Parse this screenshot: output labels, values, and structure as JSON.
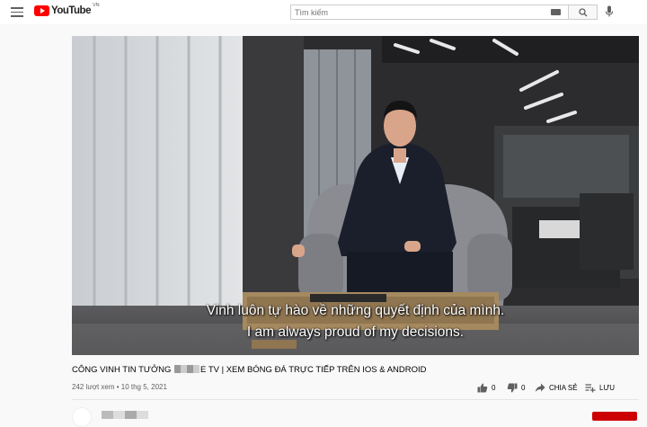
{
  "header": {
    "logo_text": "YouTube",
    "country_code": "VN",
    "search_placeholder": "Tìm kiếm"
  },
  "player": {
    "subtitle_vi": "Vinh luôn tự hào về những quyết định của mình.",
    "subtitle_en": "I am always proud of my decisions."
  },
  "video": {
    "title_prefix": "CÔNG VINH TIN TƯỞNG",
    "title_suffix": "E TV | XEM BÓNG ĐÁ TRỰC TIẾP TRÊN IOS & ANDROID",
    "meta": "242 lượt xem • 10 thg 5, 2021",
    "like_count": "0",
    "dislike_count": "0",
    "share_label": "CHIA SẺ",
    "save_label": "LƯU"
  },
  "colors": {
    "brand_red": "#ff0000",
    "subscribe_red": "#cc0000"
  }
}
